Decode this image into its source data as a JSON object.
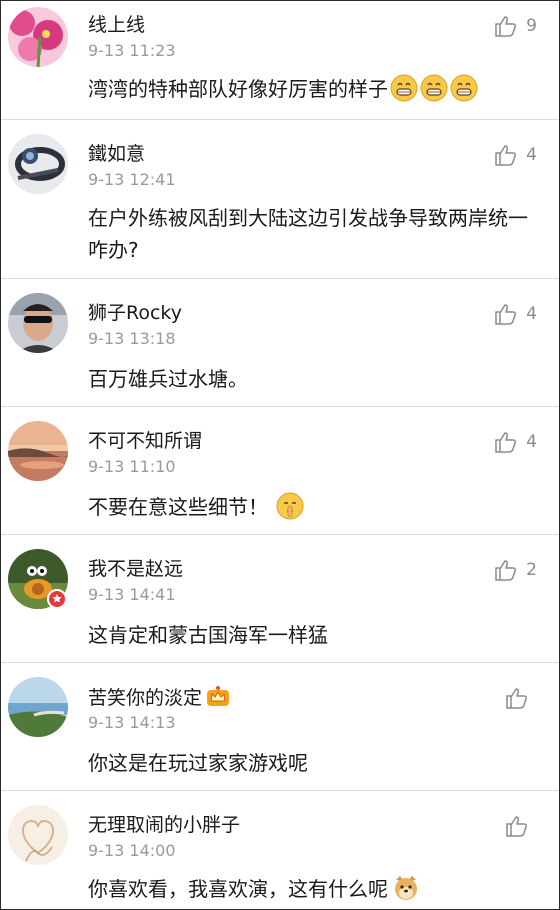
{
  "comments": [
    {
      "username": "线上线",
      "time": "9-13 11:23",
      "text": "湾湾的特种部队好像好厉害的样子",
      "likes": "9",
      "emoji": [
        "grin-emoji",
        "grin-emoji",
        "grin-emoji"
      ]
    },
    {
      "username": "鐵如意",
      "time": "9-13 12:41",
      "text": "在户外练被风刮到大陆这边引发战争导致两岸统一咋办?",
      "likes": "4"
    },
    {
      "username": "狮子Rocky",
      "time": "9-13 13:18",
      "text": "百万雄兵过水塘。",
      "likes": "4"
    },
    {
      "username": "不可不知所谓",
      "time": "9-13 11:10",
      "text": "不要在意这些细节！",
      "likes": "4",
      "emoji": [
        "shush-emoji"
      ]
    },
    {
      "username": "我不是赵远",
      "time": "9-13 14:41",
      "text": "这肯定和蒙古国海军一样猛",
      "likes": "2"
    },
    {
      "username": "苦笑你的淡定",
      "time": "9-13 14:13",
      "text": "你这是在玩过家家游戏呢",
      "likes": ""
    },
    {
      "username": "无理取闹的小胖子",
      "time": "9-13 14:00",
      "text": "你喜欢看，我喜欢演，这有什么呢",
      "likes": "",
      "emoji": [
        "doge-emoji"
      ]
    }
  ],
  "colors": {
    "text": "#1a1a1a",
    "meta": "#9a9a9a",
    "divider": "#dcdcdc",
    "badge": "#e4393c"
  }
}
